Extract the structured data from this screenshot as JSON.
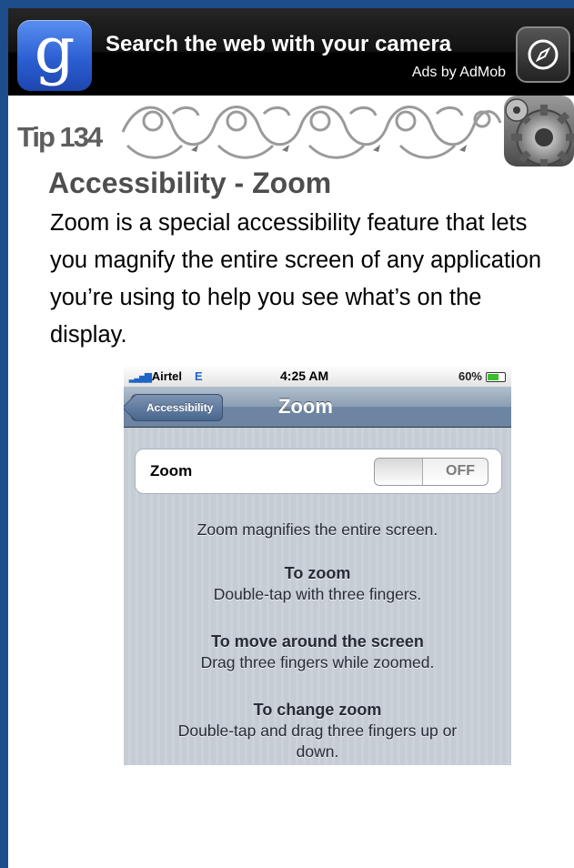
{
  "ad": {
    "logo_letter": "g",
    "headline": "Search the web with your camera",
    "attribution": "Ads by AdMob"
  },
  "tip": {
    "label": "Tip 134",
    "title": "Accessibility - Zoom",
    "description": "Zoom is a special accessibility feature that lets you magnify the entire screen of any application you’re using to help you see what’s on the display."
  },
  "phone": {
    "status_bar": {
      "carrier": "Airtel",
      "network": "E",
      "time": "4:25 AM",
      "battery": "60%",
      "battery_level": 0.6
    },
    "nav": {
      "back_label": "Accessibility",
      "title": "Zoom"
    },
    "setting": {
      "label": "Zoom",
      "toggle_state": "OFF"
    },
    "info": {
      "summary": "Zoom magnifies the entire screen.",
      "sections": [
        {
          "heading": "To zoom",
          "text": "Double-tap with three fingers."
        },
        {
          "heading": "To move around the screen",
          "text": "Drag three fingers while zoomed."
        },
        {
          "heading": "To change zoom",
          "text": "Double-tap and drag three fingers up or down."
        }
      ]
    }
  },
  "colors": {
    "frame": "#1d4d8a",
    "nav_blue": "#6d84a2",
    "battery_green": "#3cbf2c"
  }
}
